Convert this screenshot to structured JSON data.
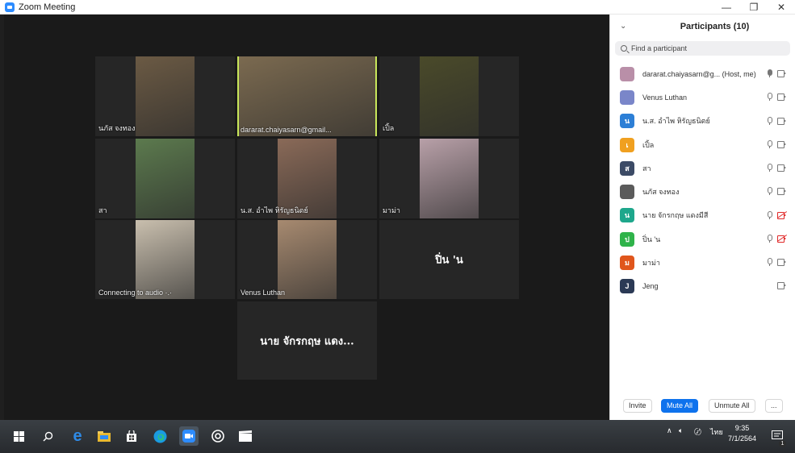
{
  "window": {
    "title": "Zoom Meeting",
    "min": "—",
    "restore": "❐",
    "close": "✕"
  },
  "participants_panel": {
    "title": "Participants (10)",
    "search_placeholder": "Find a participant",
    "participants": [
      {
        "name": "dararat.chaiyasarn@g... (Host, me)",
        "avatar_letter": "",
        "avatar_color": "#b98fa8",
        "mic": "unmuted",
        "camera": "on"
      },
      {
        "name": "Venus Luthan",
        "avatar_letter": "",
        "avatar_color": "#7a86c9",
        "mic": "muted",
        "camera": "on"
      },
      {
        "name": "น.ส. อำไพ หิรัญธนิตย์",
        "avatar_letter": "น",
        "avatar_color": "#2d7fd6",
        "mic": "muted",
        "camera": "on"
      },
      {
        "name": "เปิ้ล",
        "avatar_letter": "เ",
        "avatar_color": "#f0a020",
        "mic": "muted",
        "camera": "on"
      },
      {
        "name": "สา",
        "avatar_letter": "ส",
        "avatar_color": "#3c4b66",
        "mic": "muted",
        "camera": "on"
      },
      {
        "name": "นภัส จงทอง",
        "avatar_letter": "",
        "avatar_color": "#5b5b5b",
        "mic": "muted",
        "camera": "on"
      },
      {
        "name": "นาย จักรกฤษ แดงมีสี",
        "avatar_letter": "น",
        "avatar_color": "#1ea78c",
        "mic": "muted",
        "camera": "off"
      },
      {
        "name": "ปิ่น 'น",
        "avatar_letter": "ป",
        "avatar_color": "#2fb34a",
        "mic": "muted",
        "camera": "off"
      },
      {
        "name": "มาม่า",
        "avatar_letter": "ม",
        "avatar_color": "#e0561c",
        "mic": "muted",
        "camera": "on"
      },
      {
        "name": "Jeng",
        "avatar_letter": "J",
        "avatar_color": "#2b3a55",
        "mic": "none",
        "camera": "on"
      }
    ],
    "buttons": {
      "invite": "Invite",
      "mute_all": "Mute All",
      "unmute_all": "Unmute All",
      "more": "..."
    }
  },
  "gallery": {
    "tiles": [
      {
        "name": "นภัส จงทอง",
        "has_video": true,
        "active": false,
        "tone": "#6b5a44"
      },
      {
        "name": "dararat.chaiyasarn@gmail...",
        "has_video": true,
        "active": true,
        "tone": "#7b6a50"
      },
      {
        "name": "เปิ้ล",
        "has_video": true,
        "active": false,
        "tone": "#4a4a2a"
      },
      {
        "name": "สา",
        "has_video": true,
        "active": false,
        "tone": "#5c7a4e"
      },
      {
        "name": "น.ส. อำไพ หิรัญธนิตย์",
        "has_video": true,
        "active": false,
        "tone": "#8a6a58"
      },
      {
        "name": "มาม่า",
        "has_video": true,
        "active": false,
        "tone": "#b8a0a8"
      },
      {
        "name": "Connecting to audio ·.·",
        "has_video": true,
        "active": false,
        "tone": "#c9bfae"
      },
      {
        "name": "Venus Luthan",
        "has_video": true,
        "active": false,
        "tone": "#a78a70"
      },
      {
        "name": "ปิ่น 'น",
        "has_video": false,
        "active": false,
        "tone": ""
      },
      {
        "name": "นาย จักรกฤษ แดง...",
        "has_video": false,
        "active": false,
        "tone": ""
      }
    ]
  },
  "taskbar": {
    "lang": "ไทย",
    "time": "9:35",
    "date": "7/1/2564",
    "notification_count": "1"
  }
}
